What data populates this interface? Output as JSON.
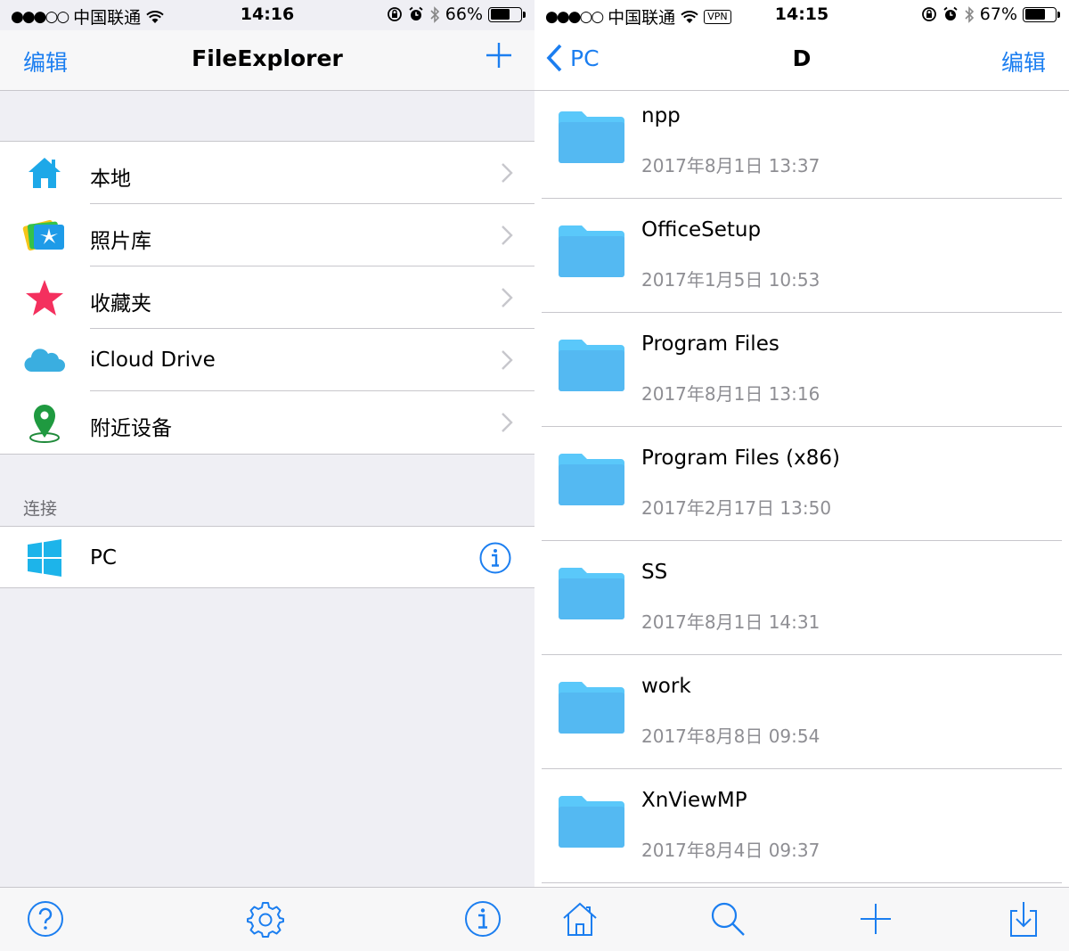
{
  "left": {
    "status": {
      "carrier": "中国联通",
      "time": "14:16",
      "battery": "66%",
      "battery_level": 0.66
    },
    "navbar": {
      "edit_label": "编辑",
      "title": "FileExplorer"
    },
    "items": [
      {
        "label": "本地",
        "icon": "home-icon"
      },
      {
        "label": "照片库",
        "icon": "photos-icon"
      },
      {
        "label": "收藏夹",
        "icon": "star-icon"
      },
      {
        "label": "iCloud Drive",
        "icon": "cloud-icon"
      },
      {
        "label": "附近设备",
        "icon": "location-pin-icon"
      }
    ],
    "section_header": "连接",
    "connection": {
      "label": "PC",
      "icon": "windows-icon"
    },
    "tabbar": [
      "help-icon",
      "gear-icon",
      "info-icon"
    ]
  },
  "right": {
    "status": {
      "carrier": "中国联通",
      "vpn": "VPN",
      "time": "14:15",
      "battery": "67%",
      "battery_level": 0.67
    },
    "navbar": {
      "back_label": "PC",
      "title": "D",
      "edit_label": "编辑"
    },
    "files": [
      {
        "name": "npp",
        "date": "2017年8月1日 13:37"
      },
      {
        "name": "OfficeSetup",
        "date": "2017年1月5日 10:53"
      },
      {
        "name": "Program Files",
        "date": "2017年8月1日 13:16"
      },
      {
        "name": "Program Files (x86)",
        "date": "2017年2月17日 13:50"
      },
      {
        "name": "SS",
        "date": "2017年8月1日 14:31"
      },
      {
        "name": "work",
        "date": "2017年8月8日 09:54"
      },
      {
        "name": "XnViewMP",
        "date": "2017年8月4日 09:37"
      }
    ],
    "tabbar": [
      "home-icon",
      "search-icon",
      "plus-icon",
      "download-icon"
    ]
  },
  "colors": {
    "accent": "#1b7ef0",
    "folder": "#5ac8fa",
    "separator": "#c8c7cc",
    "background": "#efeff4"
  }
}
